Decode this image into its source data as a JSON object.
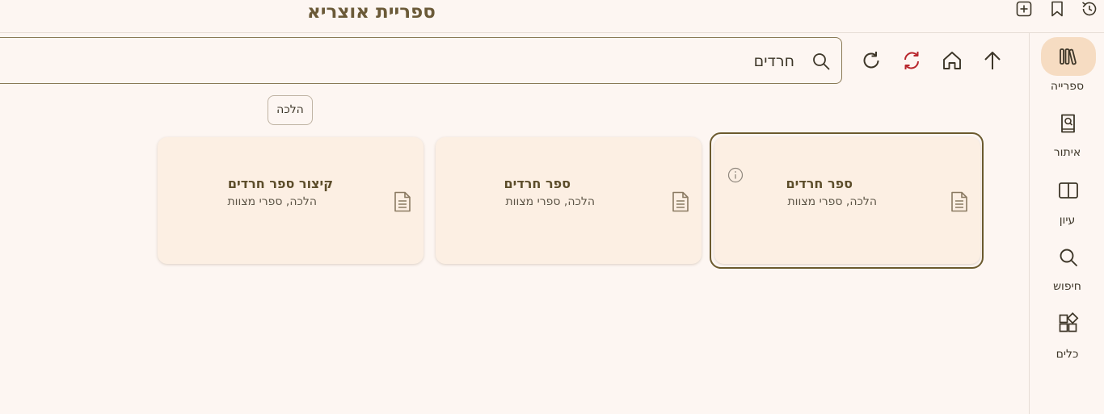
{
  "app": {
    "title": "ספריית אוצריא"
  },
  "top_icons": [
    "add-tab-icon",
    "bookmark-icon",
    "history-icon"
  ],
  "nav_rail": {
    "items": [
      {
        "label": "ספרייה",
        "icon": "library-icon",
        "selected": true
      },
      {
        "label": "איתור",
        "icon": "find-ref-icon",
        "selected": false
      },
      {
        "label": "עיון",
        "icon": "book-open-icon",
        "selected": false
      },
      {
        "label": "חיפוש",
        "icon": "search-icon",
        "selected": false
      },
      {
        "label": "כלים",
        "icon": "tools-icon",
        "selected": false
      }
    ]
  },
  "toolbar": {
    "icons": [
      "up-arrow-icon",
      "home-icon",
      "sync-icon",
      "refresh-icon"
    ]
  },
  "search": {
    "value": "חרדים",
    "placeholder": ""
  },
  "filter_chip": {
    "label": "הלכה"
  },
  "results": [
    {
      "title": "ספר חרדים",
      "subtitle": "הלכה, ספרי מצוות",
      "selected": true
    },
    {
      "title": "ספר חרדים",
      "subtitle": "הלכה, ספרי מצוות",
      "selected": false
    },
    {
      "title": "קיצור ספר חרדים",
      "subtitle": "הלכה, ספרי מצוות",
      "selected": false
    }
  ],
  "colors": {
    "background": "#fdf6f2",
    "accent": "#6b5a2e",
    "card": "#fcefe3",
    "selected_pill": "#f6dcc2",
    "sync_red": "#b8262c"
  }
}
